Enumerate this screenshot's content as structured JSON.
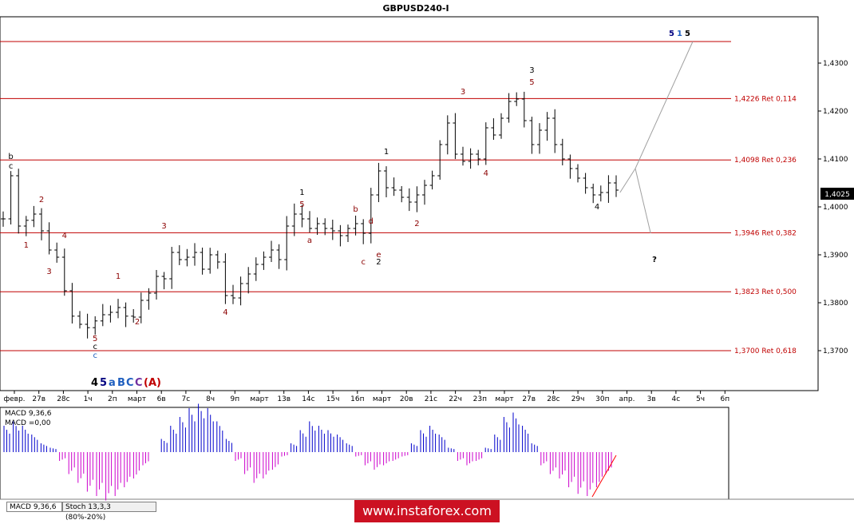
{
  "chart_data": {
    "type": "ohlc",
    "title": "GBPUSD240-I",
    "ylim": [
      1.3628,
      1.4393
    ],
    "y_ticks": [
      "1,4300",
      "1,4200",
      "1,4100",
      "1,4000",
      "1,3900",
      "1,3800",
      "1,3700"
    ],
    "current_price": "1,4025",
    "x_ticks": [
      "февр.",
      "27в",
      "28с",
      "1ч",
      "2п",
      "март",
      "6в",
      "7с",
      "8ч",
      "9п",
      "март",
      "13в",
      "14с",
      "15ч",
      "16п",
      "март",
      "20в",
      "21с",
      "22ч",
      "23п",
      "март",
      "27в",
      "28с",
      "29ч",
      "30п",
      "апр.",
      "3в",
      "4с",
      "5ч",
      "6п"
    ],
    "fib_levels": [
      {
        "label": "",
        "value": 1.4345
      },
      {
        "label": "1,4226 Ret 0,114",
        "value": 1.4226
      },
      {
        "label": "1,4098 Ret 0,236",
        "value": 1.4098
      },
      {
        "label": "1,3946 Ret 0,382",
        "value": 1.3946
      },
      {
        "label": "1,3823 Ret 0,500",
        "value": 1.3823
      },
      {
        "label": "1,3700 Ret 0,618",
        "value": 1.37
      }
    ],
    "level_color": "#c00000",
    "price_path": [
      1.3975,
      1.4065,
      1.396,
      1.3972,
      1.3985,
      1.395,
      1.391,
      1.3895,
      1.3825,
      1.3772,
      1.3755,
      1.3748,
      1.3762,
      1.3775,
      1.378,
      1.379,
      1.3772,
      1.377,
      1.3805,
      1.382,
      1.3855,
      1.385,
      1.3905,
      1.389,
      1.3895,
      1.3905,
      1.387,
      1.39,
      1.3885,
      1.3815,
      1.381,
      1.384,
      1.386,
      1.388,
      1.3895,
      1.391,
      1.389,
      1.396,
      1.3985,
      1.3975,
      1.3955,
      1.3965,
      1.3955,
      1.395,
      1.394,
      1.3955,
      1.3965,
      1.3945,
      1.4025,
      1.4075,
      1.404,
      1.4035,
      1.402,
      1.401,
      1.4025,
      1.4045,
      1.4065,
      1.413,
      1.4175,
      1.411,
      1.4095,
      1.411,
      1.41,
      1.4165,
      1.415,
      1.4185,
      1.422,
      1.4225,
      1.418,
      1.413,
      1.416,
      1.4185,
      1.413,
      1.41,
      1.408,
      1.406,
      1.404,
      1.4025,
      1.403,
      1.405,
      1.4035
    ],
    "projection": [
      {
        "bar": 80.5,
        "price": 1.403
      },
      {
        "bar": 82.5,
        "price": 1.408
      },
      {
        "bar": 90.0,
        "price": 1.4345
      }
    ],
    "projection_alt": [
      {
        "bar": 82.5,
        "price": 1.408
      },
      {
        "bar": 84.5,
        "price": 1.3945
      }
    ],
    "wave_labels": [
      {
        "text": "b",
        "bar": 1,
        "price": 1.41,
        "color": "#000000"
      },
      {
        "text": "c",
        "bar": 1,
        "price": 1.408,
        "color": "#000000"
      },
      {
        "text": "2",
        "bar": 5,
        "price": 1.401,
        "color": "#8b0000"
      },
      {
        "text": "1",
        "bar": 3,
        "price": 1.3915,
        "color": "#8b0000"
      },
      {
        "text": "4",
        "bar": 8,
        "price": 1.3935,
        "color": "#8b0000"
      },
      {
        "text": "3",
        "bar": 6,
        "price": 1.386,
        "color": "#8b0000"
      },
      {
        "text": "5",
        "bar": 12,
        "price": 1.372,
        "color": "#8b0000"
      },
      {
        "text": "c",
        "bar": 12,
        "price": 1.3703,
        "color": "#000000"
      },
      {
        "text": "c",
        "bar": 12,
        "price": 1.3685,
        "color": "#1f5fbf"
      },
      {
        "text": "1",
        "bar": 15,
        "price": 1.385,
        "color": "#8b0000"
      },
      {
        "text": "2",
        "bar": 17.5,
        "price": 1.3755,
        "color": "#8b0000"
      },
      {
        "text": "3",
        "bar": 21,
        "price": 1.3955,
        "color": "#8b0000"
      },
      {
        "text": "4",
        "bar": 29,
        "price": 1.3775,
        "color": "#8b0000"
      },
      {
        "text": "1",
        "bar": 39,
        "price": 1.4025,
        "color": "#000000"
      },
      {
        "text": "5",
        "bar": 39,
        "price": 1.4,
        "color": "#8b0000"
      },
      {
        "text": "a",
        "bar": 40,
        "price": 1.3925,
        "color": "#8b0000"
      },
      {
        "text": "b",
        "bar": 46,
        "price": 1.399,
        "color": "#8b0000"
      },
      {
        "text": "d",
        "bar": 48,
        "price": 1.3965,
        "color": "#8b0000"
      },
      {
        "text": "e",
        "bar": 49,
        "price": 1.3895,
        "color": "#8b0000"
      },
      {
        "text": "c",
        "bar": 47,
        "price": 1.388,
        "color": "#8b0000"
      },
      {
        "text": "2",
        "bar": 49,
        "price": 1.388,
        "color": "#000000"
      },
      {
        "text": "1",
        "bar": 50,
        "price": 1.411,
        "color": "#000000"
      },
      {
        "text": "2",
        "bar": 54,
        "price": 1.396,
        "color": "#8b0000"
      },
      {
        "text": "3",
        "bar": 60,
        "price": 1.4235,
        "color": "#8b0000"
      },
      {
        "text": "4",
        "bar": 63,
        "price": 1.4065,
        "color": "#8b0000"
      },
      {
        "text": "3",
        "bar": 69,
        "price": 1.428,
        "color": "#000000"
      },
      {
        "text": "5",
        "bar": 69,
        "price": 1.4255,
        "color": "#8b0000"
      },
      {
        "text": "4",
        "bar": 77.5,
        "price": 1.3995,
        "color": "#000000"
      },
      {
        "text": "?",
        "bar": 85,
        "price": 1.3885,
        "color": "#000000"
      }
    ],
    "top_labels": [
      {
        "text": "5",
        "color": "#000080"
      },
      {
        "text": "1",
        "color": "#1f5fbf"
      },
      {
        "text": "5",
        "color": "#000000"
      }
    ],
    "bottom_labels": [
      {
        "text": "4",
        "color": "#000000"
      },
      {
        "text": "5",
        "color": "#000080"
      },
      {
        "text": "a",
        "color": "#1f5fbf"
      },
      {
        "text": "B",
        "color": "#1f5fbf"
      },
      {
        "text": "C",
        "color": "#1f5fbf"
      },
      {
        "text": "C",
        "color": "#7030a0"
      },
      {
        "text": "(A)",
        "color": "#c00000"
      }
    ],
    "macd": {
      "label_1": "MACD 9,36,6",
      "label_2": "MACD =0,00",
      "positive_color": "#0000cc",
      "negative_color": "#cc00cc",
      "values": [
        0.6,
        0.7,
        0.6,
        0.4,
        0.2,
        0.1,
        -0.2,
        -0.5,
        -0.7,
        -0.9,
        -1.0,
        -1.1,
        -1.0,
        -0.8,
        -0.6,
        -0.3,
        0.0,
        0.3,
        0.6,
        0.8,
        1.0,
        1.1,
        1.0,
        0.7,
        0.3,
        -0.2,
        -0.5,
        -0.7,
        -0.6,
        -0.4,
        -0.1,
        0.2,
        0.5,
        0.7,
        0.6,
        0.5,
        0.4,
        0.2,
        -0.1,
        -0.3,
        -0.4,
        -0.3,
        -0.2,
        -0.1,
        0.2,
        0.5,
        0.6,
        0.4,
        0.1,
        -0.2,
        -0.3,
        -0.2,
        0.1,
        0.4,
        0.8,
        0.9,
        0.6,
        0.2,
        -0.3,
        -0.5,
        -0.6,
        -0.8,
        -0.95,
        -1.0,
        -0.8,
        -0.5
      ],
      "trend_line_color": "#ff0000"
    }
  },
  "tabs": {
    "tab1": "MACD 9,36,6",
    "tab2": "Stoch 13,3,3 (80%-20%)"
  },
  "watermark": "www.instaforex.com"
}
